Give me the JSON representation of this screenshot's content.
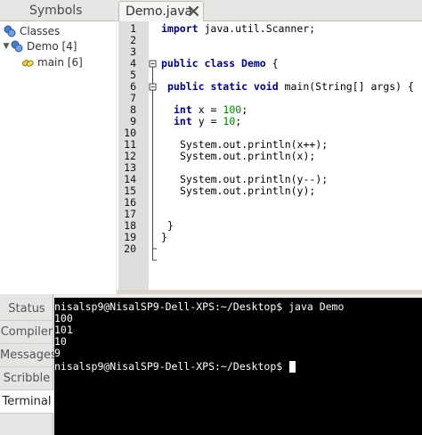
{
  "symbols": {
    "tab_label": "Symbols",
    "tree": [
      {
        "label": "Classes",
        "icon": "classes-icon",
        "arrow": ""
      },
      {
        "label": "Demo [4]",
        "icon": "class-icon",
        "arrow": "▼"
      },
      {
        "label": "main [6]",
        "icon": "method-icon",
        "arrow": ""
      }
    ]
  },
  "editor": {
    "tab_label": "Demo.java",
    "line_numbers": [
      "1",
      "2",
      "3",
      "4",
      "5",
      "6",
      "7",
      "8",
      "9",
      "10",
      "11",
      "12",
      "13",
      "14",
      "15",
      "16",
      "17",
      "18",
      "19",
      "20"
    ],
    "code": {
      "l1_kw": "import",
      "l1_rest": " java.util.Scanner;",
      "l4_kw": "public class",
      "l4_name": " Demo",
      "l4_rest": " {",
      "l6_kw": "public static void",
      "l6_rest": " main(String[] args) {",
      "l8_kw": "int",
      "l8_mid": " x = ",
      "l8_num": "100",
      "l8_end": ";",
      "l9_kw": "int",
      "l9_mid": " y = ",
      "l9_num": "10",
      "l9_end": ";",
      "l11": "System.out.println(x++);",
      "l12": "System.out.println(x);",
      "l14": "System.out.println(y--);",
      "l15": "System.out.println(y);",
      "l18": "}",
      "l19": "}"
    }
  },
  "bottom_tabs": [
    "Status",
    "Compiler",
    "Messages",
    "Scribble",
    "Terminal"
  ],
  "active_bottom_tab": "Terminal",
  "terminal": {
    "lines": [
      "nisalsp9@NisalSP9-Dell-XPS:~/Desktop$ java Demo",
      "100",
      "101",
      "10",
      "9",
      "nisalsp9@NisalSP9-Dell-XPS:~/Desktop$ "
    ]
  },
  "colors": {
    "keyword": "#00007f",
    "number": "#007f00",
    "terminal_bg": "#000000",
    "gutter_bg": "#dedede"
  }
}
